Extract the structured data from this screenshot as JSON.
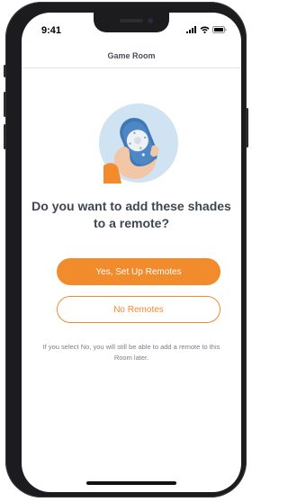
{
  "status_bar": {
    "time": "9:41",
    "icons": [
      "signal-icon",
      "wifi-icon",
      "battery-icon"
    ]
  },
  "header": {
    "title": "Game Room"
  },
  "illustration": {
    "icon": "hand-holding-remote-icon"
  },
  "prompt": {
    "question": "Do you want to add these shades to a remote?"
  },
  "actions": {
    "primary_label": "Yes, Set Up Remotes",
    "secondary_label": "No Remotes"
  },
  "footer": {
    "note": "If you select No, you will still be able to add a remote to this Room later."
  },
  "colors": {
    "accent": "#f28b2c",
    "text_dark": "#3e4651",
    "text_muted": "#7a7f86",
    "illustration_bg": "#cfe3f2",
    "remote_blue": "#3f78b5"
  }
}
